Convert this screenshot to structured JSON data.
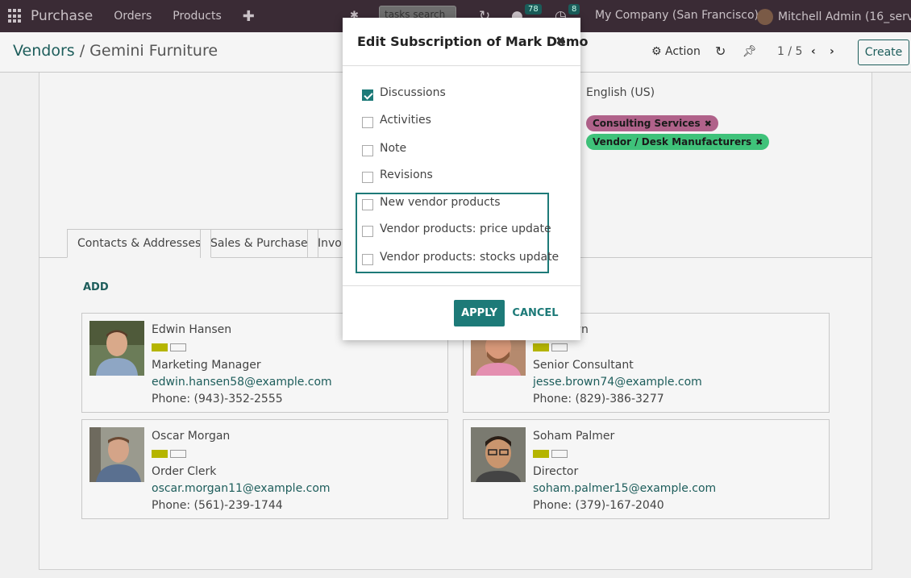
{
  "topbar": {
    "app_name": "Purchase",
    "menu": [
      "Orders",
      "Products"
    ],
    "search_placeholder": "tasks search",
    "messages_count": "78",
    "activities_count": "8",
    "company": "My Company (San Francisco)",
    "user": "Mitchell Admin (16_server"
  },
  "controlbar": {
    "breadcrumb_parent": "Vendors",
    "breadcrumb_sep": "/",
    "breadcrumb_current": "Gemini Furniture",
    "action_label": "Action",
    "pager": "1 / 5",
    "create_label": "Create"
  },
  "form": {
    "language": "English (US)",
    "tags": [
      {
        "label": "Consulting Services",
        "color": "#b0628a"
      },
      {
        "label": "Vendor / Desk Manufacturers",
        "color": "#3fc27a"
      }
    ]
  },
  "tabs": [
    "Contacts & Addresses",
    "Sales & Purchase",
    "Invoi"
  ],
  "add_label": "ADD",
  "contacts": [
    {
      "name": "Edwin Hansen",
      "role": "Marketing Manager",
      "email": "edwin.hansen58@example.com",
      "phone": "Phone: (943)-352-2555"
    },
    {
      "name": "own",
      "role": "Senior Consultant",
      "email": "jesse.brown74@example.com",
      "phone": "Phone: (829)-386-3277"
    },
    {
      "name": "Oscar Morgan",
      "role": "Order Clerk",
      "email": "oscar.morgan11@example.com",
      "phone": "Phone: (561)-239-1744"
    },
    {
      "name": "Soham Palmer",
      "role": "Director",
      "email": "soham.palmer15@example.com",
      "phone": "Phone: (379)-167-2040"
    }
  ],
  "modal": {
    "title": "Edit Subscription of Mark Demo",
    "options": [
      {
        "label": "Discussions",
        "checked": true
      },
      {
        "label": "Activities",
        "checked": false
      },
      {
        "label": "Note",
        "checked": false
      },
      {
        "label": "Revisions",
        "checked": false
      },
      {
        "label": "New vendor products",
        "checked": false
      },
      {
        "label": "Vendor products: price update",
        "checked": false
      },
      {
        "label": "Vendor products: stocks update",
        "checked": false
      }
    ],
    "apply_label": "APPLY",
    "cancel_label": "CANCEL"
  },
  "colors": {
    "topbar": "#3a2b35",
    "accent": "#1d7a78",
    "link": "#1d5d5b"
  }
}
